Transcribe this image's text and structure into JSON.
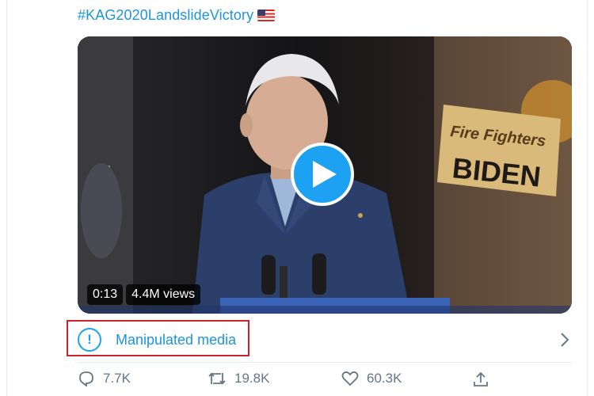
{
  "tweet": {
    "hashtag": "#KAG2020LandslideVictory",
    "flag_icon": "us-flag-emoji"
  },
  "video": {
    "time": "0:13",
    "views": "4.4M views",
    "sign_line1": "Fire Fighters",
    "sign_line2": "BIDEN",
    "play_icon": "play-icon"
  },
  "label": {
    "text": "Manipulated media",
    "alert_glyph": "!",
    "highlight_color": "#cc2229"
  },
  "actions": {
    "reply_count": "7.7K",
    "retweet_count": "19.8K",
    "like_count": "60.3K"
  },
  "colors": {
    "link": "#1b95e0",
    "accent": "#1da1f2",
    "muted": "#657786"
  }
}
